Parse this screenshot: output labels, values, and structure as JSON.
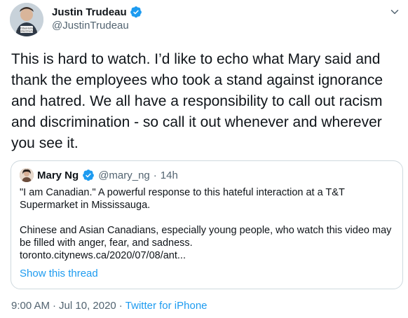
{
  "author": {
    "name": "Justin Trudeau",
    "handle": "@JustinTrudeau",
    "avatar_badge": "#StayHome #RestezChezVous"
  },
  "tweet": {
    "text": "This is hard to watch. I’d like to echo what Mary said and thank the employees who took a stand against ignorance and hatred. We all have a responsibility to call out racism and discrimination - so call it out whenever and wherever you see it."
  },
  "quote": {
    "name": "Mary Ng",
    "handle": "@mary_ng",
    "separator": "·",
    "time": "14h",
    "line1": "\"I am Canadian.\" A powerful response to this hateful interaction at a T&T Supermarket in Mississauga.",
    "line2": "Chinese and Asian Canadians, especially young people, who watch this video may be filled with anger, fear, and sadness.",
    "line3": "toronto.citynews.ca/2020/07/08/ant...",
    "show_thread": "Show this thread"
  },
  "footer": {
    "time": "9:00 AM",
    "separator1": "·",
    "date": "Jul 10, 2020",
    "separator2": "·",
    "source": "Twitter for iPhone"
  },
  "colors": {
    "verified": "#1d9bf0",
    "link": "#1d9bf0",
    "muted": "#536471",
    "border": "#cfd9de"
  },
  "icons": {
    "verified": "verified-badge-icon",
    "more": "chevron-down-icon"
  }
}
